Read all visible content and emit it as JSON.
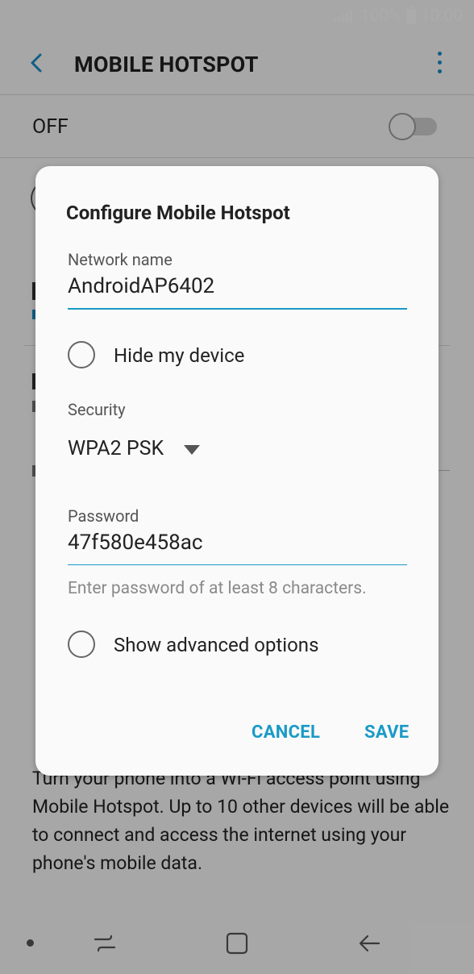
{
  "status_bar": {
    "battery": "100%",
    "time": "10:00"
  },
  "app_bar": {
    "title": "MOBILE HOTSPOT"
  },
  "toggle_row": {
    "label": "OFF",
    "state": "off"
  },
  "description": {
    "paragraph": "Turn your phone into a Wi-Fi access point using Mobile Hotspot. Up to 10 other devices will be able to connect and access the internet using your phone's mobile data."
  },
  "dialog": {
    "title": "Configure Mobile Hotspot",
    "network_name": {
      "label": "Network name",
      "value": "AndroidAP6402"
    },
    "hide_device": {
      "label": "Hide my device",
      "checked": false
    },
    "security": {
      "label": "Security",
      "selected": "WPA2 PSK"
    },
    "password": {
      "label": "Password",
      "value": "47f580e458ac",
      "hint": "Enter password of at least 8 characters."
    },
    "advanced": {
      "label": "Show advanced options",
      "checked": false
    },
    "buttons": {
      "cancel": "CANCEL",
      "save": "SAVE"
    }
  },
  "colors": {
    "accent": "#1a9ac6",
    "scrim": "rgba(0,0,0,0.33)"
  },
  "icons": {
    "back": "back-arrow-icon",
    "more": "more-vert-icon",
    "signal": "signal-icon",
    "battery": "battery-icon",
    "recents": "recents-icon",
    "home": "home-icon",
    "nav_back": "nav-back-icon"
  }
}
